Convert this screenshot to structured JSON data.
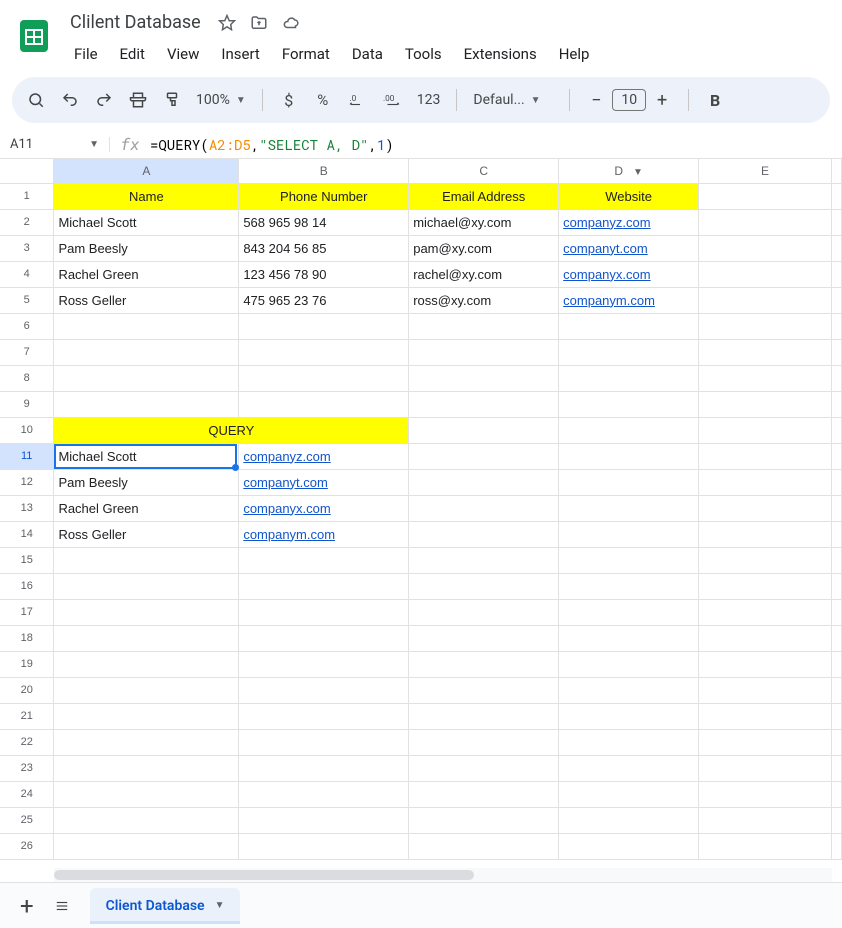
{
  "doc": {
    "title": "Clilent Database"
  },
  "menus": [
    "File",
    "Edit",
    "View",
    "Insert",
    "Format",
    "Data",
    "Tools",
    "Extensions",
    "Help"
  ],
  "toolbar": {
    "zoom": "100%",
    "number_format": "123",
    "font_name": "Defaul...",
    "font_size": "10"
  },
  "namebox": "A11",
  "formula": {
    "prefix": "=QUERY(",
    "range": "A2:D5",
    "sep1": ", ",
    "str": "\"SELECT A, D\"",
    "sep2": ", ",
    "num": "1",
    "suffix": ")"
  },
  "columns": [
    "A",
    "B",
    "C",
    "D",
    "E"
  ],
  "headers": {
    "A": "Name",
    "B": "Phone Number",
    "C": "Email Address",
    "D": "Website"
  },
  "rows": [
    {
      "name": "Michael Scott",
      "phone": "568 965 98 14",
      "email": "michael@xy.com",
      "website": "companyz.com"
    },
    {
      "name": "Pam Beesly",
      "phone": "843 204 56 85",
      "email": "pam@xy.com",
      "website": "companyt.com"
    },
    {
      "name": "Rachel Green",
      "phone": "123 456 78 90",
      "email": "rachel@xy.com",
      "website": "companyx.com"
    },
    {
      "name": "Ross Geller",
      "phone": "475 965 23 76",
      "email": "ross@xy.com",
      "website": "companym.com"
    }
  ],
  "query_header": "QUERY",
  "query_rows": [
    {
      "name": "Michael Scott",
      "website": "companyz.com"
    },
    {
      "name": "Pam Beesly",
      "website": "companyt.com"
    },
    {
      "name": "Rachel Green",
      "website": "companyx.com"
    },
    {
      "name": "Ross Geller",
      "website": "companym.com"
    }
  ],
  "sheet_tab": "Client Database"
}
